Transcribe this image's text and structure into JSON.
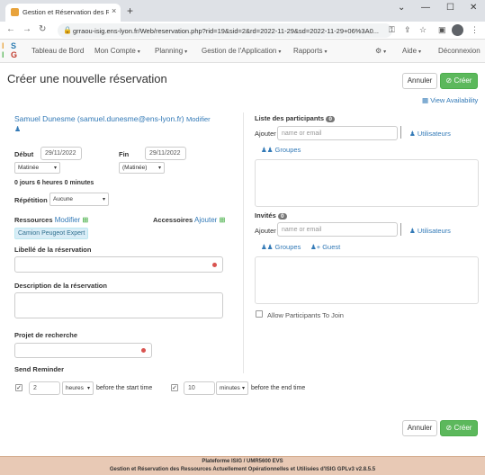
{
  "browser": {
    "tab_title": "Gestion et Réservation des Resso",
    "tab_close": "×",
    "new_tab": "+",
    "url": "grraou-isig.ens-lyon.fr/Web/reservation.php?rid=19&sid=2&rd=2022-11-29&sd=2022-11-29+06%3A0..."
  },
  "nav": {
    "logo_letters": "ISIG",
    "items": [
      {
        "label": "Tableau de Bord",
        "dropdown": false
      },
      {
        "label": "Mon Compte",
        "dropdown": true
      },
      {
        "label": "Planning",
        "dropdown": true
      },
      {
        "label": "Gestion de l'Application",
        "dropdown": true
      },
      {
        "label": "Rapports",
        "dropdown": true
      }
    ],
    "settings_caret": "▾",
    "help": "Aide",
    "logout": "Déconnexion"
  },
  "page": {
    "title": "Créer une nouvelle réservation",
    "cancel": "Annuler",
    "create": "Créer",
    "view_availability": "View Availability",
    "user": "Samuel Dunesme (samuel.dunesme@ens-lyon.fr)",
    "modify": "Modifier",
    "start_label": "Début",
    "start_date": "29/11/2022",
    "start_slot": "Matinée",
    "end_label": "Fin",
    "end_date": "29/11/2022",
    "end_slot": "(Matinée)",
    "duration": "0 jours 6 heures 0 minutes",
    "repeat_label": "Répétition",
    "repeat_value": "Aucune",
    "resources_label": "Ressources",
    "resources_modify": "Modifier",
    "accessories_label": "Accessoires",
    "accessories_add": "Ajouter",
    "resource_tag": "Camion Peugeot Expert",
    "title_field_label": "Libellé de la réservation",
    "description_label": "Description de la réservation",
    "project_label": "Projet de recherche",
    "reminder_label": "Send Reminder",
    "reminder_start_value": "2",
    "reminder_start_unit": "heures",
    "reminder_start_text": "before the start time",
    "reminder_end_value": "10",
    "reminder_end_unit": "minutes",
    "reminder_end_text": "before the end time",
    "participants_label": "Liste des participants",
    "participants_count": "0",
    "add_label": "Ajouter",
    "name_or_email": "name or email",
    "users_link": "Utilisateurs",
    "groups_link": "Groupes",
    "invitees_label": "Invités",
    "invitees_count": "0",
    "guest_link": "Guest",
    "allow_join": "Allow Participants To Join"
  },
  "footer": {
    "line1": "Plateforme ISIG / UMR5600 EVS",
    "line2": "Gestion et Réservation des Ressources Actuellement Opérationnelles et Utilisées d'ISIG GPLv3 v2.8.5.5"
  },
  "colors": {
    "success": "#5cb85c",
    "link": "#337ab7",
    "footer_bg": "#e8c9b5",
    "required": "#d9534f"
  }
}
